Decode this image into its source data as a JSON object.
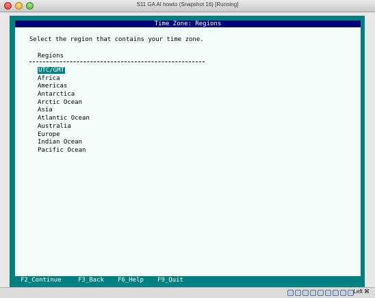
{
  "window": {
    "title": "S11 GA AI howto (Snapshot 16) [Running]"
  },
  "installer": {
    "header": "Time Zone: Regions",
    "prompt": "Select the region that contains your time zone.",
    "list_heading": "Regions",
    "selected_index": 0,
    "regions": [
      "UTC/GMT",
      "Africa",
      "Americas",
      "Antarctica",
      "Arctic Ocean",
      "Asia",
      "Atlantic Ocean",
      "Australia",
      "Europe",
      "Indian Ocean",
      "Pacific Ocean"
    ],
    "function_keys": [
      "F2_Continue",
      "F3_Back",
      "F6_Help",
      "F9_Quit"
    ]
  },
  "statusbar": {
    "icons": [
      "hard-disk-icon",
      "cd-icon",
      "usb-icon",
      "shared-folder-icon",
      "network-icon",
      "display-icon",
      "capture-icon",
      "mouse-integration-icon",
      "keyboard-icon"
    ],
    "host_key": "Left ⌘"
  },
  "colors": {
    "screen_teal": "#008080",
    "header_navy": "#00007a",
    "panel_bg": "#f2fdf9",
    "selection_bg": "#008080"
  }
}
